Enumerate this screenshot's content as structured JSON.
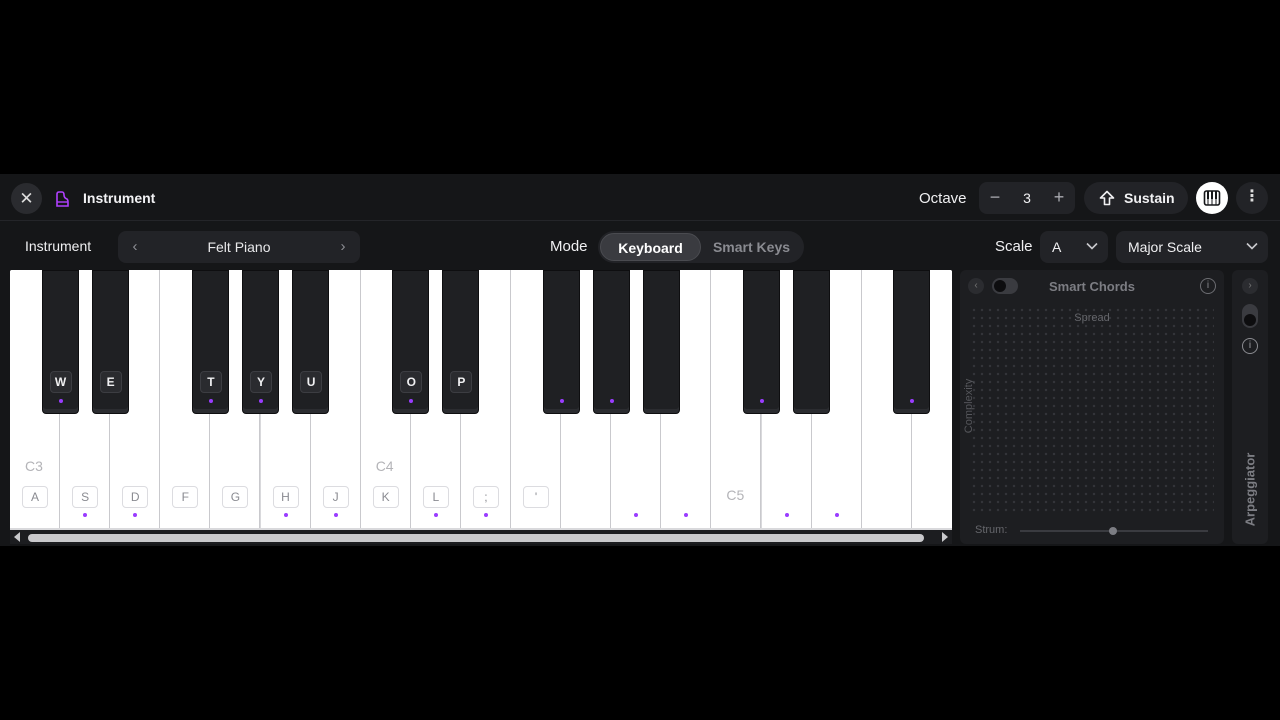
{
  "topbar": {
    "close_icon": "close-icon",
    "title": "Instrument",
    "octave_label": "Octave",
    "octave_minus": "−",
    "octave_value": "3",
    "octave_plus": "+",
    "sustain_label": "Sustain",
    "more_icon": "⋮",
    "accent_color": "#9a3cff"
  },
  "controls": {
    "instrument_label": "Instrument",
    "instrument_prev": "‹",
    "instrument_name": "Felt Piano",
    "instrument_next": "›",
    "mode_label": "Mode",
    "mode_options": [
      "Keyboard",
      "Smart Keys"
    ],
    "mode_selected": "Keyboard",
    "scale_label": "Scale",
    "scale_key": "A",
    "scale_type": "Major Scale"
  },
  "keyboard": {
    "octave_labels": [
      "C3",
      "C4",
      "C5"
    ],
    "white_key_labels": [
      "A",
      "S",
      "D",
      "F",
      "G",
      "H",
      "J",
      "K",
      "L",
      ";",
      "'"
    ],
    "black_key_labels": [
      "W",
      "E",
      "T",
      "Y",
      "U",
      "O",
      "P"
    ]
  },
  "smart_chords": {
    "title": "Smart Chords",
    "spread_label": "Spread",
    "complexity_label": "Complexity",
    "strum_label": "Strum:",
    "back_icon": "‹",
    "info_icon": "i",
    "strum_value_fraction": 0.5
  },
  "arpeggiator": {
    "label": "Arpeggiator",
    "forward_icon": "›",
    "info_icon": "i"
  }
}
